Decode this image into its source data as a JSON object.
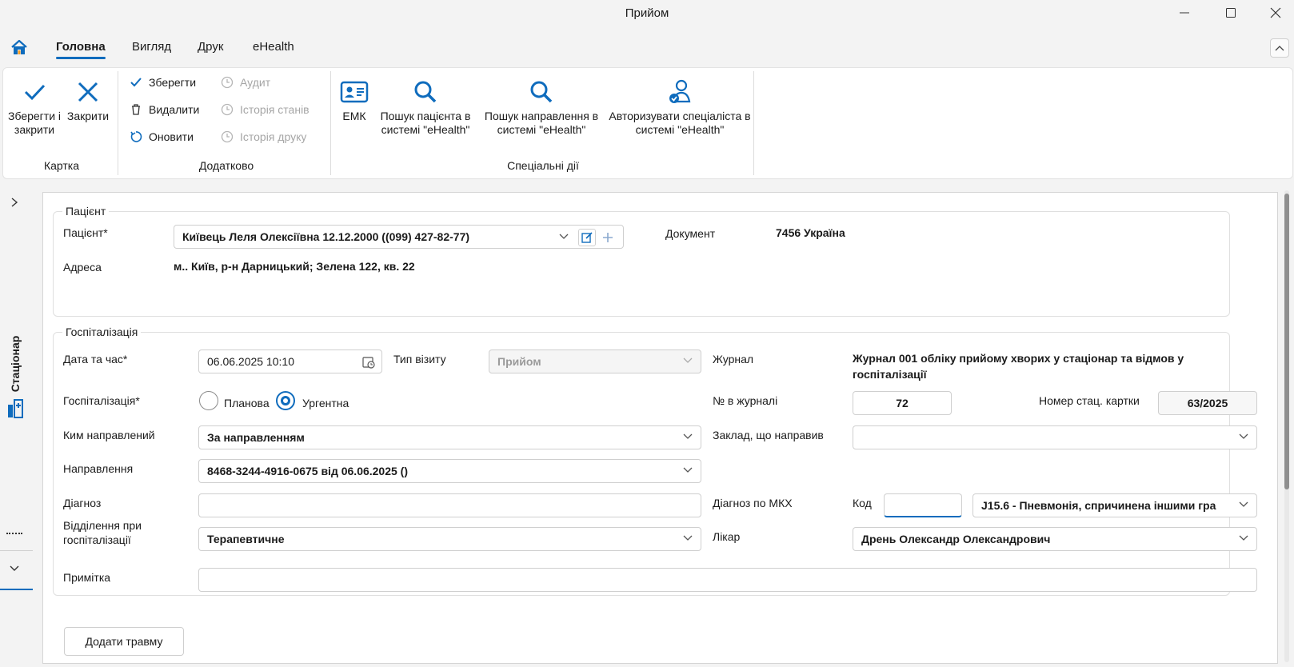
{
  "window": {
    "title": "Прийом"
  },
  "tabs": [
    {
      "label": "Головна",
      "active": true
    },
    {
      "label": "Вигляд"
    },
    {
      "label": "Друк"
    },
    {
      "label": "eHealth"
    }
  ],
  "ribbon": {
    "save_close": "Зберегти і закрити",
    "close": "Закрити",
    "group_card": "Картка",
    "save": "Зберегти",
    "delete": "Видалити",
    "refresh": "Оновити",
    "audit": "Аудит",
    "state_history": "Історія станів",
    "print_history": "Історія друку",
    "group_extra": "Додатково",
    "emk": "ЕМК",
    "search_patient": "Пошук пацієнта в системі \"eHealth\"",
    "search_referral": "Пошук направлення в системі \"eHealth\"",
    "authorize": "Авторизувати спеціаліста в системі \"eHealth\"",
    "group_special": "Спеціальні дії"
  },
  "sidebar": {
    "label": "Стаціонар"
  },
  "patient": {
    "legend": "Пацієнт",
    "patient_label": "Пацієнт*",
    "patient_value": "Київець Леля Олексіївна 12.12.2000 ((099) 427-82-77)",
    "document_label": "Документ",
    "document_value": "7456 Україна",
    "address_label": "Адреса",
    "address_value": "м.. Київ, р-н Дарницький; Зелена 122, кв. 22"
  },
  "hosp": {
    "legend": "Госпіталізація",
    "datetime_label": "Дата та час*",
    "datetime_value": "06.06.2025 10:10",
    "visit_type_label": "Тип візиту",
    "visit_type_value": "Прийом",
    "journal_label": "Журнал",
    "journal_value": "Журнал 001 обліку прийому хворих у стаціонар та відмов у госпіталізації",
    "hosp_label": "Госпіталізація*",
    "planned": "Планова",
    "urgent": "Ургентна",
    "selected": "urgent",
    "journal_no_label": "№ в журналі",
    "journal_no_value": "72",
    "card_no_label": "Номер стац. картки",
    "card_no_value": "63/2025",
    "referred_by_label": "Ким направлений",
    "referred_by_value": "За направленням",
    "ref_facility_label": "Заклад, що направив",
    "ref_facility_value": "",
    "referral_label": "Направлення",
    "referral_value": "8468-3244-4916-0675 від 06.06.2025 ()",
    "diagnosis_label": "Діагноз",
    "diagnosis_value": "",
    "icd_label": "Діагноз по МКХ",
    "code_label": "Код",
    "code_value": "",
    "icd_value": "J15.6 - Пневмонія, спричинена іншими гра",
    "dept_label": "Відділення при госпіталізації",
    "dept_value": "Терапевтичне",
    "doctor_label": "Лікар",
    "doctor_value": "Дрень Олександр Олександрович",
    "note_label": "Примітка",
    "note_value": ""
  },
  "add_injury": "Додати травму",
  "colors": {
    "accent": "#0f6cbd"
  }
}
